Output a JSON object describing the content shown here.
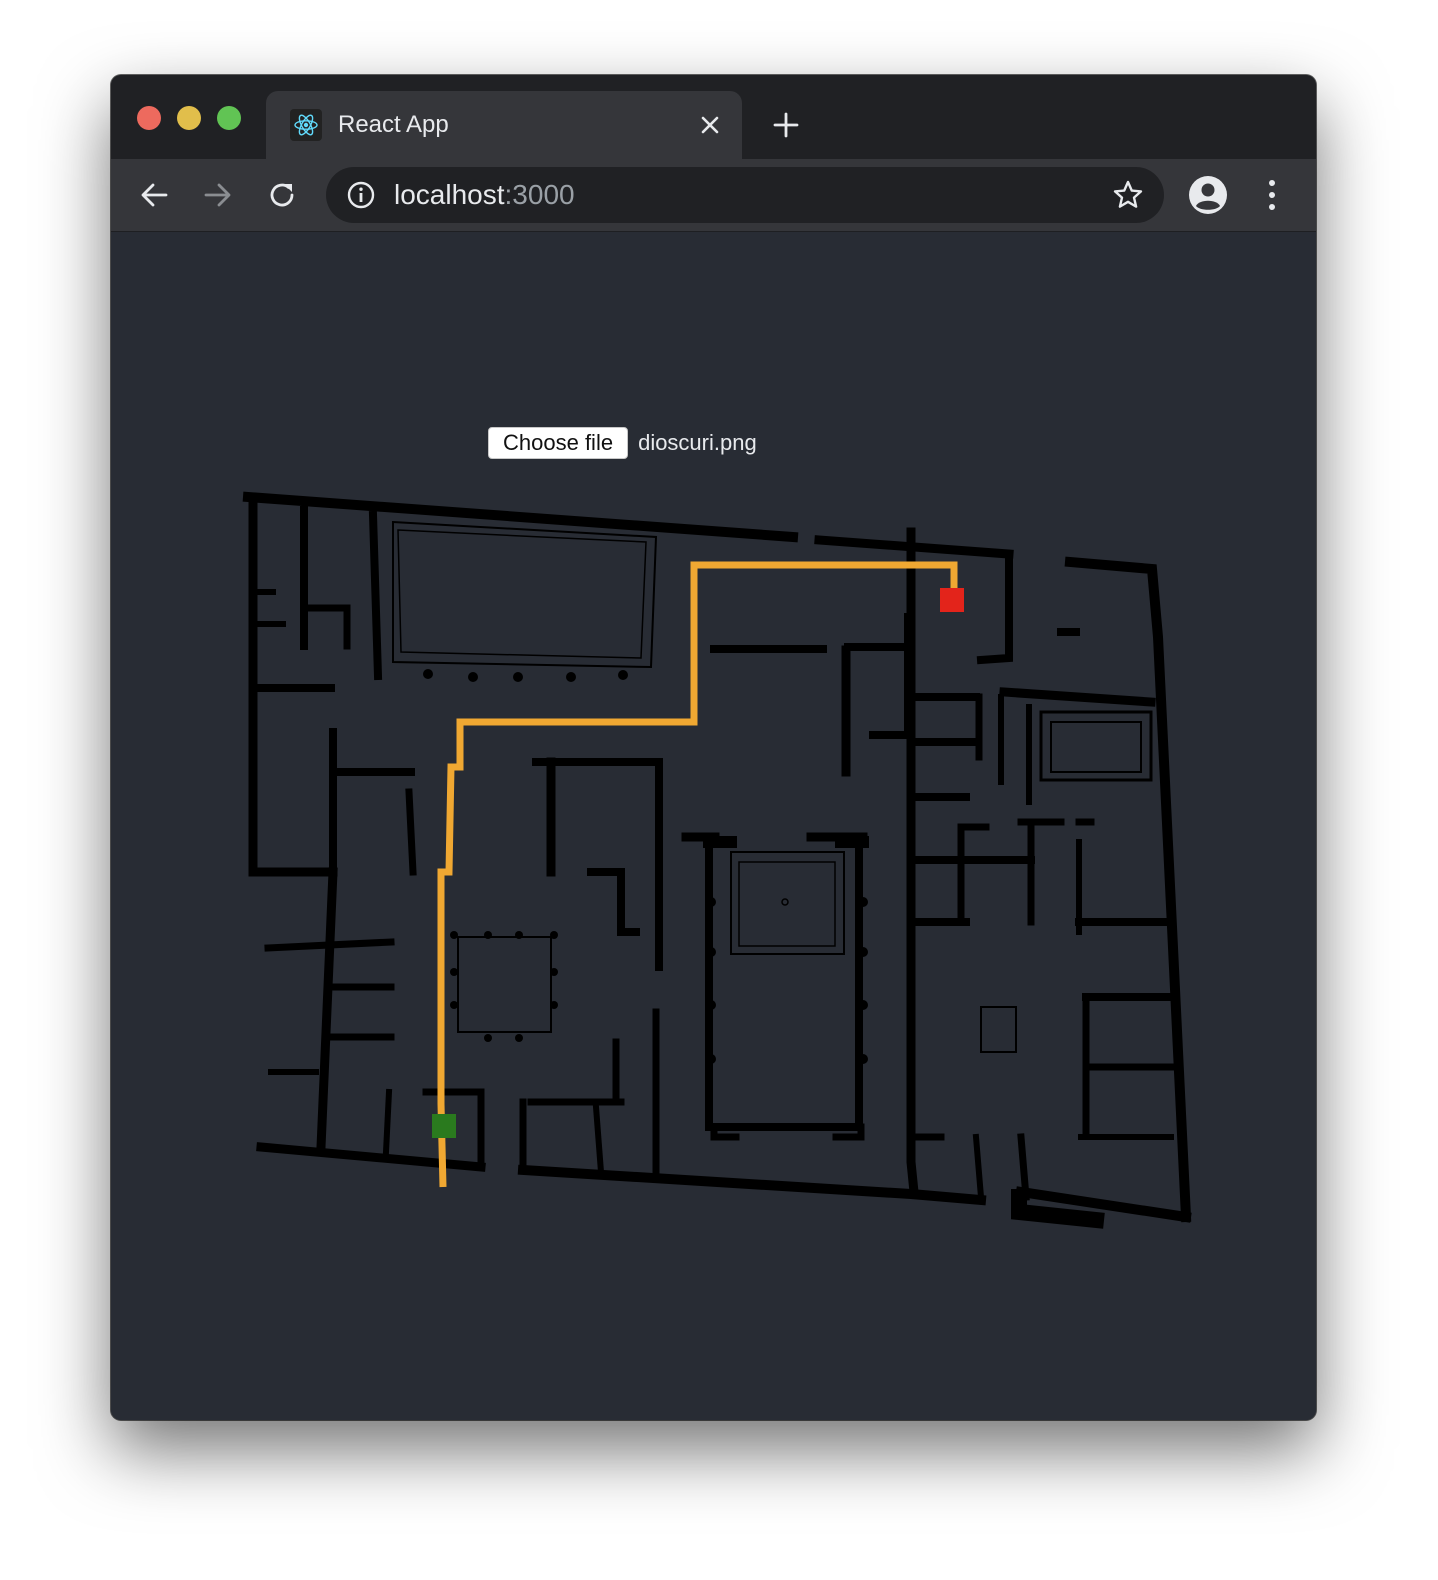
{
  "browser": {
    "tab_title": "React App",
    "favicon": "react-logo-icon",
    "url_host": "localhost",
    "url_port": ":3000"
  },
  "icons": {
    "back": "arrow-left-icon",
    "forward": "arrow-right-icon",
    "reload": "reload-icon",
    "site_info": "info-icon",
    "bookmark": "star-icon",
    "profile": "account-icon",
    "menu": "more-vert-icon",
    "close_tab": "close-icon",
    "new_tab": "plus-icon"
  },
  "uploader": {
    "button_label": "Choose file",
    "file_name": "dioscuri.png"
  },
  "map": {
    "path_color": "#f0a832",
    "start_color": "#2a7a1e",
    "end_color": "#e3241b",
    "wall_color": "#000000"
  },
  "colors": {
    "page_background": "#282c34",
    "tabbar": "#202124",
    "toolbar": "#35363a"
  }
}
